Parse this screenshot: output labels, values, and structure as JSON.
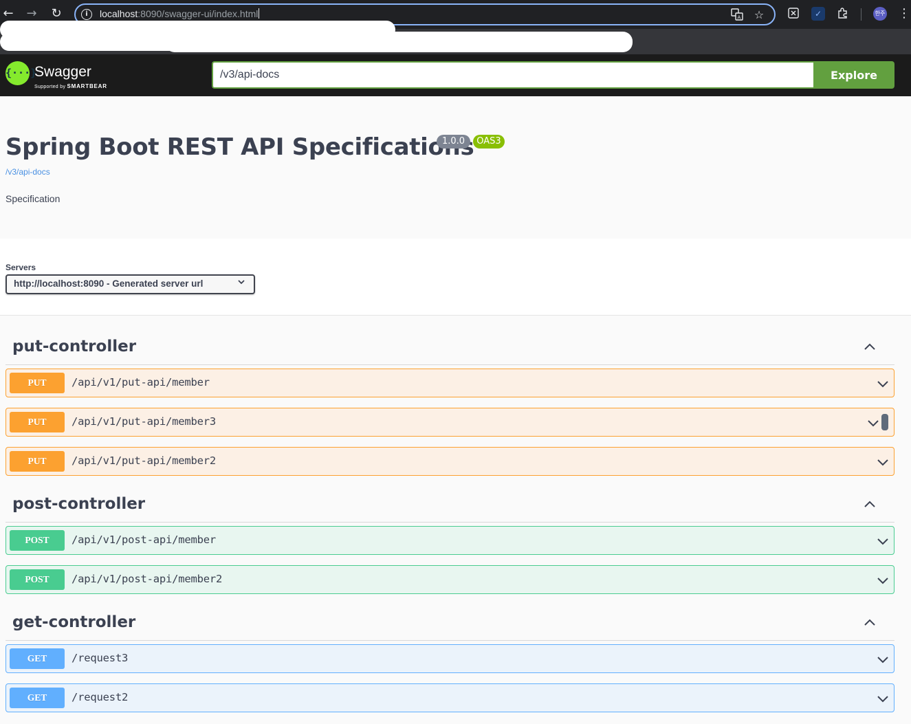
{
  "browser": {
    "back_icon": "←",
    "forward_icon": "→",
    "reload_icon": "↻",
    "url_host": "localhost",
    "url_rest": ":8090/swagger-ui/index.html",
    "translate_icon": "translate-icon",
    "star_icon": "☆",
    "profile_initials": "한주",
    "accent": "#8ab4f8"
  },
  "topbar": {
    "logo_text": "Swagger",
    "logo_sub_prefix": "Supported by",
    "logo_sub_brand": "SMARTBEAR",
    "logo_glyph": "{···}",
    "spec_url": "/v3/api-docs",
    "explore_label": "Explore",
    "brand_color": "#62a03f"
  },
  "info": {
    "title": "Spring Boot REST API Specifications",
    "version_badge": "1.0.0",
    "oas_badge": "OAS3",
    "spec_link": "/v3/api-docs",
    "description": "Specification"
  },
  "servers": {
    "label": "Servers",
    "selected": "http://localhost:8090 - Generated server url"
  },
  "tags": [
    {
      "name": "put-controller",
      "operations": [
        {
          "method": "PUT",
          "path": "/api/v1/put-api/member"
        },
        {
          "method": "PUT",
          "path": "/api/v1/put-api/member3"
        },
        {
          "method": "PUT",
          "path": "/api/v1/put-api/member2"
        }
      ]
    },
    {
      "name": "post-controller",
      "operations": [
        {
          "method": "POST",
          "path": "/api/v1/post-api/member"
        },
        {
          "method": "POST",
          "path": "/api/v1/post-api/member2"
        }
      ]
    },
    {
      "name": "get-controller",
      "operations": [
        {
          "method": "GET",
          "path": "/request3"
        },
        {
          "method": "GET",
          "path": "/request2"
        }
      ]
    }
  ],
  "method_colors": {
    "PUT": "#fca130",
    "POST": "#49cc90",
    "GET": "#61affe"
  }
}
